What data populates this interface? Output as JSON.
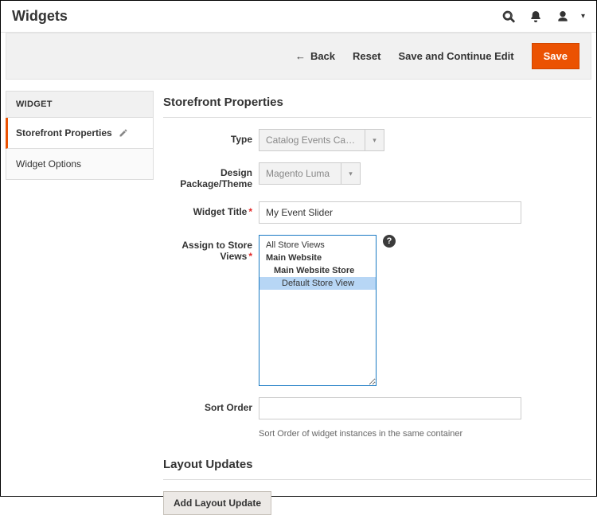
{
  "topbar": {
    "title": "Widgets"
  },
  "actions": {
    "back": "Back",
    "reset": "Reset",
    "save_continue": "Save and Continue Edit",
    "save": "Save"
  },
  "sidebar": {
    "header": "WIDGET",
    "items": [
      {
        "label": "Storefront Properties",
        "active": true
      },
      {
        "label": "Widget Options",
        "active": false
      }
    ]
  },
  "storefront": {
    "title": "Storefront Properties",
    "fields": {
      "type": {
        "label": "Type",
        "value": "Catalog Events Carousel"
      },
      "theme": {
        "label": "Design Package/Theme",
        "value": "Magento Luma"
      },
      "widget_title": {
        "label": "Widget Title",
        "value": "My Event Slider",
        "required": true
      },
      "store_views": {
        "label": "Assign to Store Views",
        "required": true,
        "help": "?",
        "options": [
          {
            "label": "All Store Views",
            "level": 0,
            "bold": false,
            "selected": false
          },
          {
            "label": "Main Website",
            "level": 0,
            "bold": true,
            "selected": false
          },
          {
            "label": "Main Website Store",
            "level": 1,
            "bold": true,
            "selected": false
          },
          {
            "label": "Default Store View",
            "level": 2,
            "bold": false,
            "selected": true
          }
        ]
      },
      "sort_order": {
        "label": "Sort Order",
        "value": "",
        "hint": "Sort Order of widget instances in the same container"
      }
    }
  },
  "layout": {
    "title": "Layout Updates",
    "add_button": "Add Layout Update"
  }
}
